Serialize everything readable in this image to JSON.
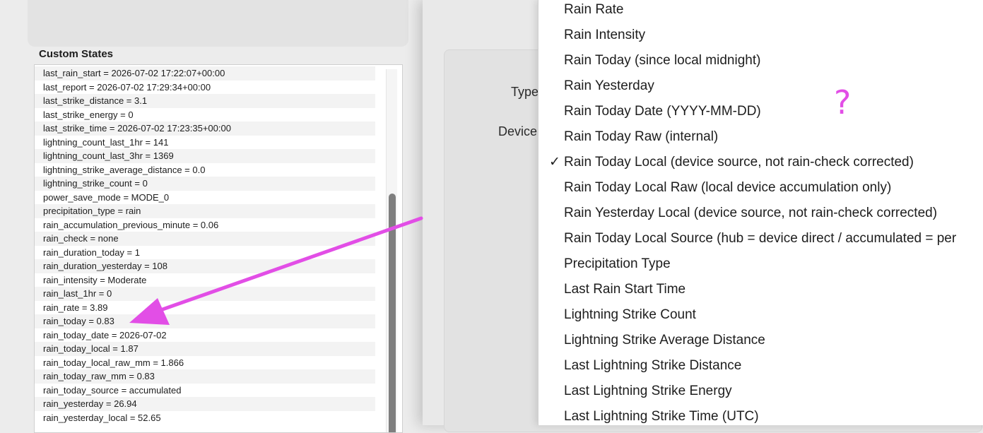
{
  "left_panel": {
    "section_title": "Custom States",
    "states": [
      "last_rain_start = 2026-07-02 17:22:07+00:00",
      "last_report = 2026-07-02 17:29:34+00:00",
      "last_strike_distance = 3.1",
      "last_strike_energy = 0",
      "last_strike_time = 2026-07-02 17:23:35+00:00",
      "lightning_count_last_1hr = 141",
      "lightning_count_last_3hr = 1369",
      "lightning_strike_average_distance = 0.0",
      "lightning_strike_count = 0",
      "power_save_mode = MODE_0",
      "precipitation_type = rain",
      "rain_accumulation_previous_minute = 0.06",
      "rain_check = none",
      "rain_duration_today = 1",
      "rain_duration_yesterday = 108",
      "rain_intensity = Moderate",
      "rain_last_1hr = 0",
      "rain_rate = 3.89",
      "rain_today = 0.83",
      "rain_today_date = 2026-07-02",
      "rain_today_local = 1.87",
      "rain_today_local_raw_mm = 1.866",
      "rain_today_raw_mm = 0.83",
      "rain_today_source = accumulated",
      "rain_yesterday = 26.94",
      "rain_yesterday_local = 52.65"
    ]
  },
  "dialog": {
    "type_label": "Type",
    "device_label": "Device"
  },
  "menu": {
    "selected_index": 6,
    "check_glyph": "✓",
    "items": [
      "Rain Rate",
      "Rain Intensity",
      "Rain Today (since local midnight)",
      "Rain Yesterday",
      "Rain Today Date (YYYY-MM-DD)",
      "Rain Today Raw (internal)",
      "Rain Today Local (device source, not rain-check corrected)",
      "Rain Today Local Raw (local device accumulation only)",
      "Rain Yesterday Local (device source, not rain-check corrected)",
      "Rain Today Local Source (hub = device direct / accumulated = per",
      "Precipitation Type",
      "Last Rain Start Time",
      "Lightning Strike Count",
      "Lightning Strike Average Distance",
      "Last Lightning Strike Distance",
      "Last Lightning Strike Energy",
      "Last Lightning Strike Time (UTC)"
    ]
  },
  "annotation": {
    "question_mark": "?",
    "color": "#e24ee6"
  }
}
